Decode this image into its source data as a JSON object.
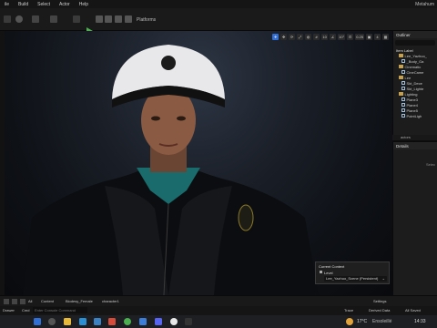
{
  "menu": {
    "items": [
      "ile",
      "Build",
      "Select",
      "Actor",
      "Help"
    ],
    "window_title": "Metahum"
  },
  "toolbar": {
    "platforms_label": "Platforms"
  },
  "viewport": {
    "camera_speed": "0.25",
    "grid_value": "10",
    "fov_value": "10°",
    "snap_value": "4"
  },
  "outliner": {
    "title": "Outliner",
    "column_header": "Item Label",
    "items": [
      {
        "label": "Lee_Yazhuo_",
        "type": "folder",
        "indent": 2
      },
      {
        "label": "_Body_Ga",
        "type": "actor",
        "indent": 3
      },
      {
        "label": "Cinematic",
        "type": "folder",
        "indent": 2
      },
      {
        "label": "CineCame",
        "type": "actor",
        "indent": 3
      },
      {
        "label": "Lee",
        "type": "folder",
        "indent": 2
      },
      {
        "label": "Skt_Dece",
        "type": "actor",
        "indent": 3
      },
      {
        "label": "Skt_Lighte",
        "type": "actor",
        "indent": 3
      },
      {
        "label": "Lighting",
        "type": "folder",
        "indent": 2
      },
      {
        "label": "Plane3",
        "type": "actor",
        "indent": 3
      },
      {
        "label": "Plane4",
        "type": "actor",
        "indent": 3
      },
      {
        "label": "Plane5",
        "type": "actor",
        "indent": 3
      },
      {
        "label": "PointLigh",
        "type": "actor",
        "indent": 3
      }
    ],
    "actors_count": "actors"
  },
  "details": {
    "title": "Details",
    "hint": "Selec"
  },
  "context": {
    "title": "Current Context",
    "level_label": "Level",
    "level_value": "Lee_Yazhuo_Scene (Persistent)"
  },
  "content_bar": {
    "crumbs": [
      "All",
      "Content",
      "Biodesy_Female",
      "character1"
    ],
    "settings_label": "Settings"
  },
  "bottom_bar": {
    "drawer_label": "Drawer",
    "cmd_label": "Cmd",
    "cmd_placeholder": "Enter Console Command",
    "trace_label": "Trace",
    "derived_data_label": "Derived Data",
    "all_saved_label": "All Saved"
  },
  "taskbar": {
    "weather": "17°C",
    "weather_desc": "Ensoleillé",
    "time": "14:33"
  },
  "colors": {
    "accent_blue": "#2f6fd6",
    "play_green": "#4caf50",
    "folder_gold": "#c8a04a"
  }
}
